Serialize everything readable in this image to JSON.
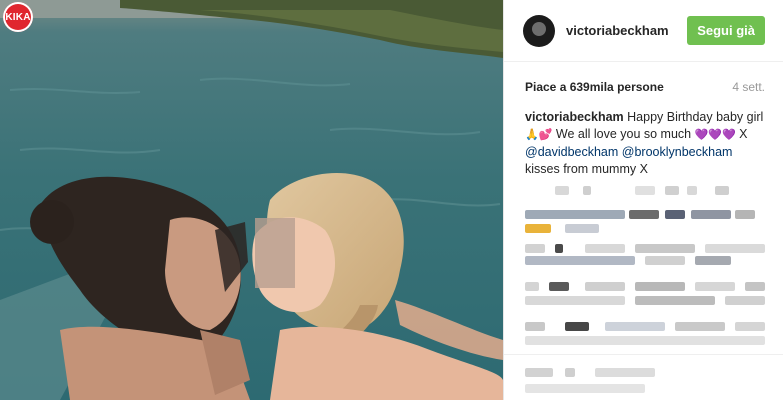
{
  "logo": {
    "text": "KIKA"
  },
  "post": {
    "username": "victoriabeckham",
    "follow_label": "Segui già",
    "likes": "Piace a 639mila persone",
    "time": "4 sett.",
    "caption": {
      "user": "victoriabeckham",
      "text1": " Happy Birthday baby girl",
      "emoji_line": "🙏💕",
      "text2": " We all love you so much ",
      "emoji_hearts": "💜💜💜",
      "text3": " X",
      "mention1": "@davidbeckham",
      "mention2": "@brooklynbeckham",
      "text4": " kisses from mummy X"
    }
  },
  "colors": {
    "follow": "#70c050",
    "mention": "#003569"
  }
}
